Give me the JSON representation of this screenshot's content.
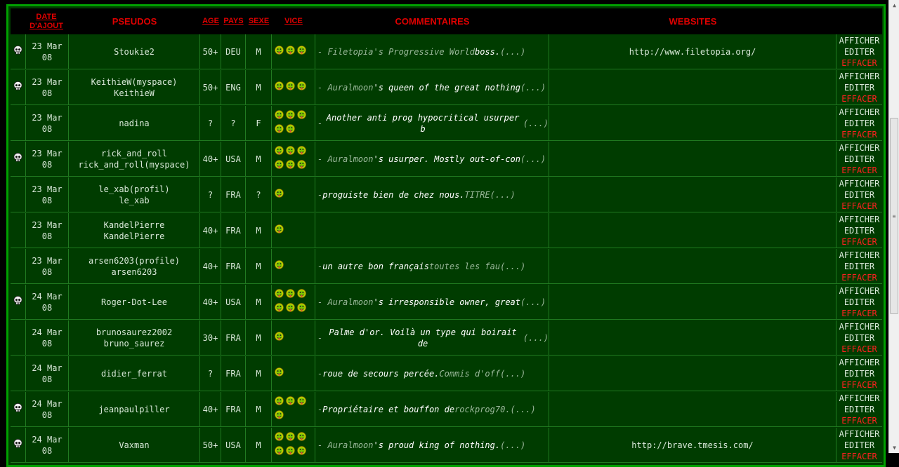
{
  "headers": {
    "date": "DATE D'AJOUT",
    "pseudos": "PSEUDOS",
    "age": "AGE",
    "pays": "PAYS",
    "sexe": "SEXE",
    "vice": "VICE",
    "commentaires": "COMMENTAIRES",
    "websites": "WEBSITES"
  },
  "actions": {
    "show": "AFFICHER",
    "edit": "EDITER",
    "delete": "EFFACER"
  },
  "colors": {
    "header_text": "#e00000",
    "row_bg": "#003c00",
    "border": "#00a000",
    "delete": "#ff2020"
  },
  "rows": [
    {
      "skull": true,
      "date1": "23 Mar",
      "date2": "08",
      "p1": "Stoukie2",
      "p2": "",
      "age": "50+",
      "pays": "DEU",
      "sexe": "M",
      "vices": 3,
      "c1": "- Filetopia's Progressive World",
      "c2": " boss.",
      "c3": " (...)",
      "web": "http://www.filetopia.org/"
    },
    {
      "skull": true,
      "date1": "23 Mar",
      "date2": "08",
      "p1": "KeithieW(myspace)",
      "p2": "KeithieW",
      "age": "50+",
      "pays": "ENG",
      "sexe": "M",
      "vices": 3,
      "c1": "- Auralmoon",
      "c2": "'s queen of the great nothing",
      "c3": "(...)",
      "web": ""
    },
    {
      "skull": false,
      "date1": "23 Mar",
      "date2": "08",
      "p1": "nadina",
      "p2": "",
      "age": "?",
      "pays": "?",
      "sexe": "F",
      "vices": 5,
      "c1": "- ",
      "c2": "Another anti prog hypocritical usurper b",
      "c3": "(...)",
      "web": ""
    },
    {
      "skull": true,
      "date1": "23 Mar",
      "date2": "08",
      "p1": "rick_and_roll",
      "p2": "rick_and_roll(myspace)",
      "age": "40+",
      "pays": "USA",
      "sexe": "M",
      "vices": 6,
      "c1": "- Auralmoon",
      "c2": "'s usurper. Mostly out-of-con",
      "c3": "(...)",
      "web": ""
    },
    {
      "skull": false,
      "date1": "23 Mar",
      "date2": "08",
      "p1": "le_xab(profil)",
      "p2": "le_xab",
      "age": "?",
      "pays": "FRA",
      "sexe": "?",
      "vices": 1,
      "c1": "- ",
      "c2": "proguiste bien de chez nous.",
      "c3": " TITRE(...)",
      "web": ""
    },
    {
      "skull": false,
      "date1": "23 Mar",
      "date2": "08",
      "p1": "KandelPierre",
      "p2": "KandelPierre",
      "age": "40+",
      "pays": "FRA",
      "sexe": "M",
      "vices": 1,
      "c1": "",
      "c2": "",
      "c3": "",
      "web": ""
    },
    {
      "skull": false,
      "date1": "23 Mar",
      "date2": "08",
      "p1": "arsen6203(profile)",
      "p2": "arsen6203",
      "age": "40+",
      "pays": "FRA",
      "sexe": "M",
      "vices": 1,
      "c1": "- ",
      "c2": "un autre bon français",
      "c3": " toutes les fau(...)",
      "web": ""
    },
    {
      "skull": true,
      "date1": "24 Mar",
      "date2": "08",
      "p1": "Roger-Dot-Lee",
      "p2": "",
      "age": "40+",
      "pays": "USA",
      "sexe": "M",
      "vices": 6,
      "c1": "- Auralmoon",
      "c2": "'s irresponsible owner, great",
      "c3": "(...)",
      "web": ""
    },
    {
      "skull": false,
      "date1": "24 Mar",
      "date2": "08",
      "p1": "brunosaurez2002",
      "p2": "bruno_saurez",
      "age": "30+",
      "pays": "FRA",
      "sexe": "M",
      "vices": 1,
      "c1": "- ",
      "c2": "Palme d'or. Voilà un type qui boirait de",
      "c3": "(...)",
      "web": ""
    },
    {
      "skull": false,
      "date1": "24 Mar",
      "date2": "08",
      "p1": "didier_ferrat",
      "p2": "",
      "age": "?",
      "pays": "FRA",
      "sexe": "M",
      "vices": 1,
      "c1": "- ",
      "c2": "roue de secours percée.",
      "c3": " Commis d'off(...)",
      "web": ""
    },
    {
      "skull": true,
      "date1": "24 Mar",
      "date2": "08",
      "p1": "jeanpaulpiller",
      "p2": "",
      "age": "40+",
      "pays": "FRA",
      "sexe": "M",
      "vices": 4,
      "c1": "- ",
      "c2": "Propriétaire et bouffon de",
      "c3": " rockprog70.(...)",
      "web": ""
    },
    {
      "skull": true,
      "date1": "24 Mar",
      "date2": "08",
      "p1": "Vaxman",
      "p2": "",
      "age": "50+",
      "pays": "USA",
      "sexe": "M",
      "vices": 6,
      "c1": "- Auralmoon",
      "c2": "'s proud king of nothing.",
      "c3": " (...)",
      "web": "http://brave.tmesis.com/"
    }
  ]
}
